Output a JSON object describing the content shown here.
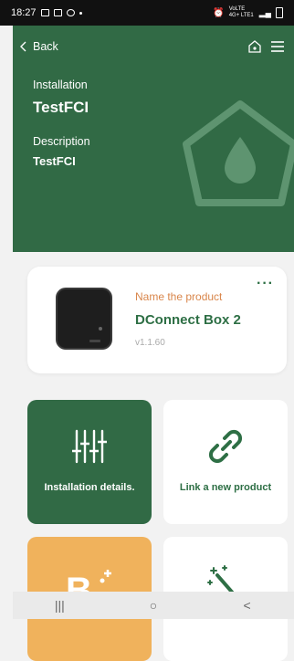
{
  "status_bar": {
    "time": "18:27",
    "network": "VoLTE 4G+ LTE1"
  },
  "header": {
    "back_label": "Back",
    "home_icon": "home-icon",
    "menu_icon": "menu-icon",
    "installation_label": "Installation",
    "installation_name": "TestFCI",
    "description_label": "Description",
    "description_value": "TestFCI",
    "background_color": "#316a45"
  },
  "product": {
    "name_label": "Name the product",
    "title": "DConnect Box 2",
    "version": "v1.1.60",
    "more_label": "···"
  },
  "tiles": [
    {
      "label": "Installation details.",
      "icon": "sliders-icon",
      "color": "#316a45"
    },
    {
      "label": "Link a new product",
      "icon": "link-icon",
      "color": "#ffffff"
    },
    {
      "label": "",
      "icon": "product-add-icon",
      "color": "#f0b25c"
    },
    {
      "label": "",
      "icon": "magic-wand-icon",
      "color": "#ffffff"
    }
  ],
  "nav": {
    "recents": "|||",
    "home": "○",
    "back": "<"
  }
}
